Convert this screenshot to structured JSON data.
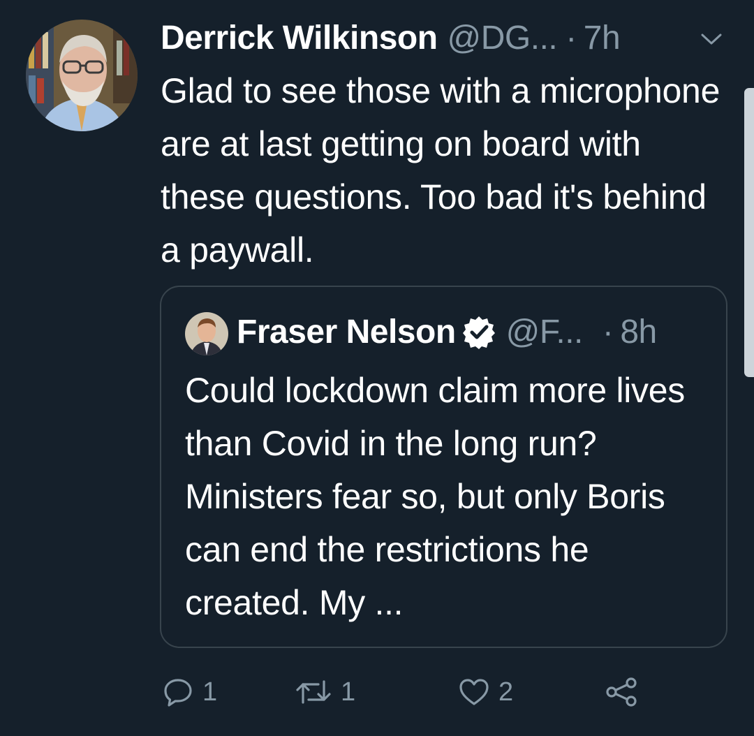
{
  "tweet": {
    "author": {
      "display_name": "Derrick Wilkinson",
      "handle": "@DG...",
      "avatar_icon": "avatar-derrick-wilkinson"
    },
    "separator": "·",
    "time": "7h",
    "menu_icon": "chevron-down-icon",
    "text": "Glad to see those with a microphone are at last getting on board with these questions. Too bad it's behind a paywall."
  },
  "quoted_tweet": {
    "author": {
      "display_name": "Fraser Nelson",
      "handle": "@F...",
      "verified": true,
      "avatar_icon": "avatar-fraser-nelson"
    },
    "separator": "·",
    "time": "8h",
    "text": "Could lockdown claim more lives than Covid in the long run? Ministers fear so, but only Boris can end the restrictions he created. My ..."
  },
  "actions": {
    "reply": {
      "icon": "reply-icon",
      "count": "1"
    },
    "retweet": {
      "icon": "retweet-icon",
      "count": "1"
    },
    "like": {
      "icon": "heart-icon",
      "count": "2"
    },
    "share": {
      "icon": "share-icon"
    }
  },
  "colors": {
    "background": "#15202b",
    "text_primary": "#ffffff",
    "text_secondary": "#8899a6",
    "border": "#38444d"
  }
}
